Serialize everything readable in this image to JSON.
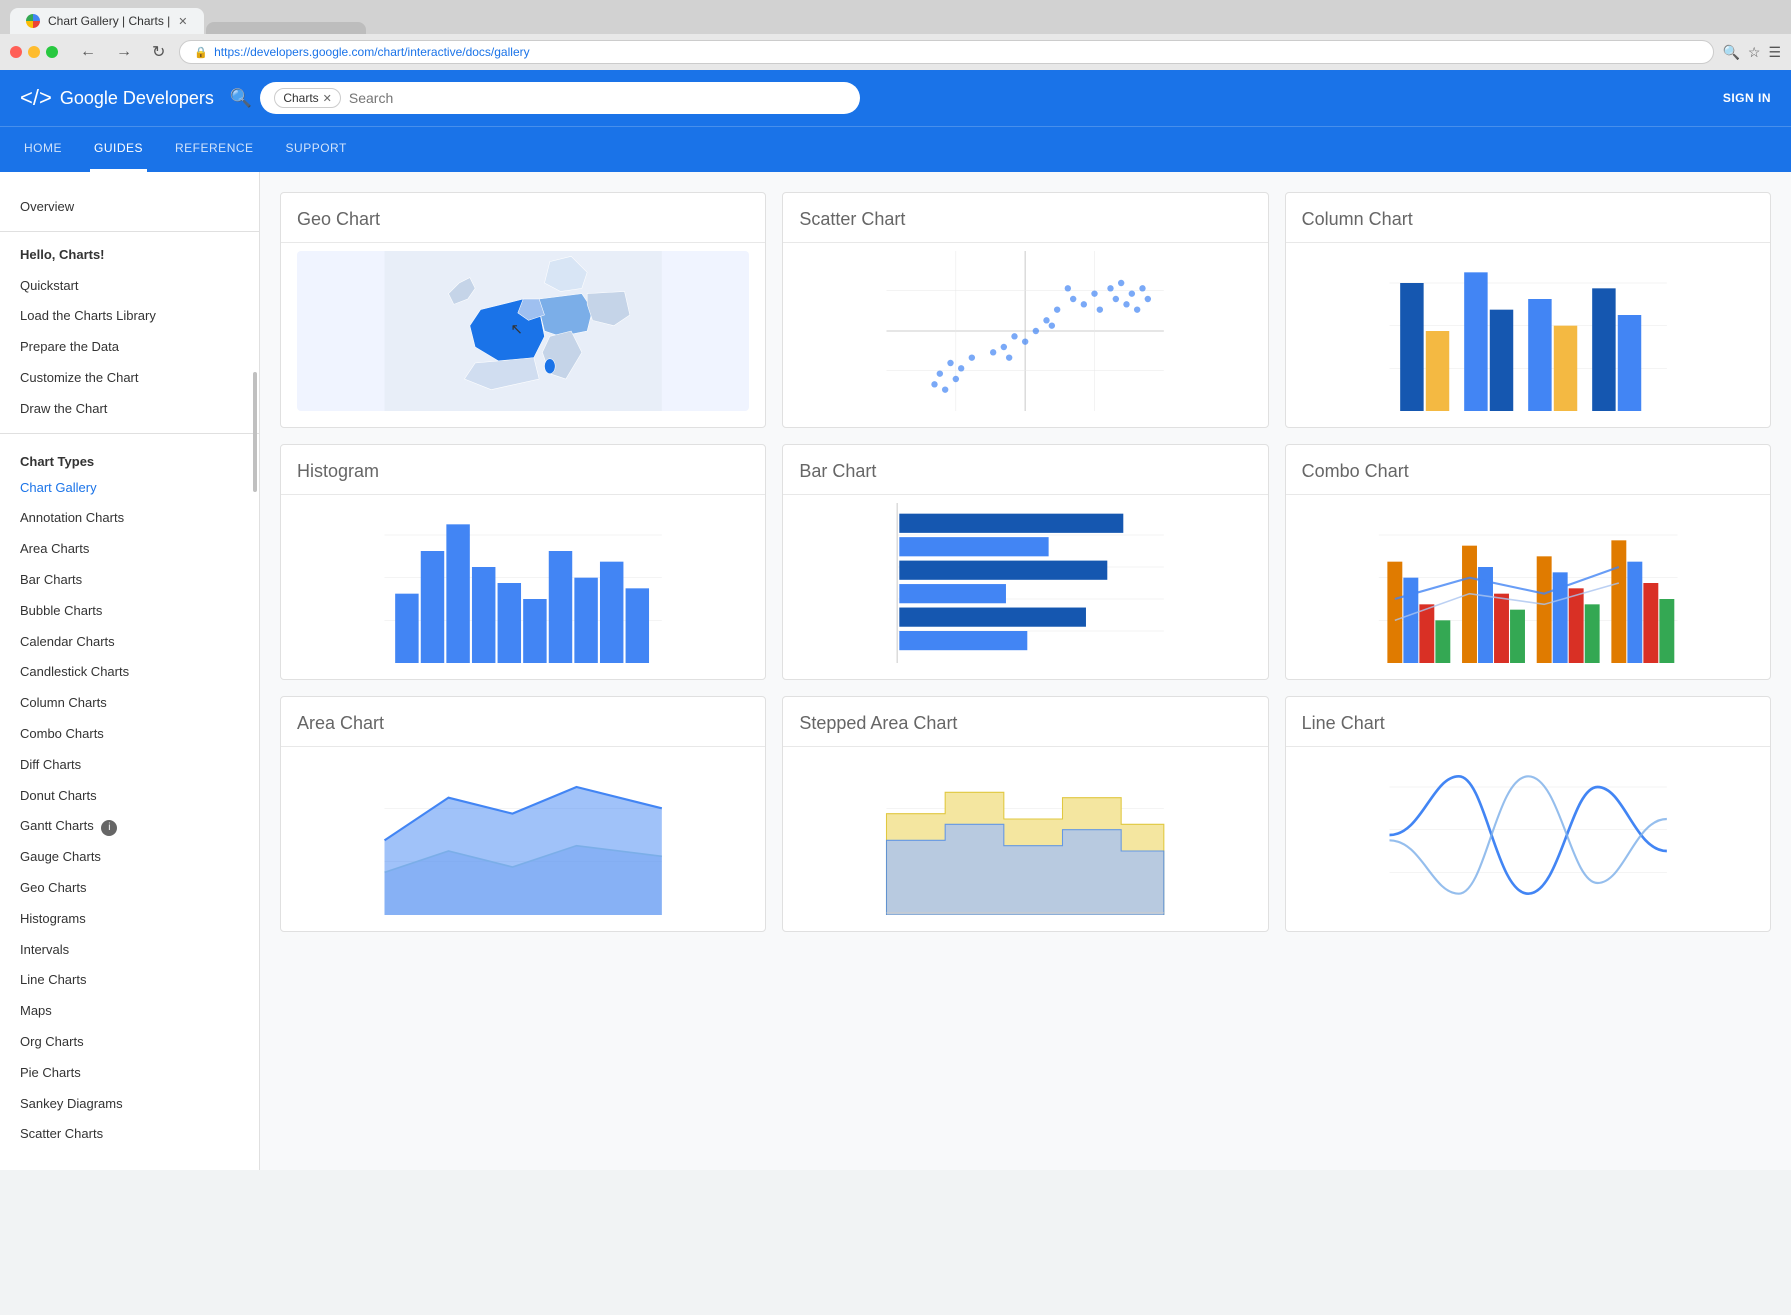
{
  "browser": {
    "tab_favicon": "chart-favicon",
    "tab_title": "Chart Gallery | Charts |",
    "url": "https://developers.google.com/chart/interactive/docs/gallery",
    "search_placeholder": "Search"
  },
  "header": {
    "logo_text": "Google Developers",
    "search_tag": "Charts",
    "search_placeholder": "Search",
    "sign_in": "SIGN IN"
  },
  "nav": {
    "items": [
      {
        "label": "HOME",
        "active": false
      },
      {
        "label": "GUIDES",
        "active": true
      },
      {
        "label": "REFERENCE",
        "active": false
      },
      {
        "label": "SUPPORT",
        "active": false
      }
    ]
  },
  "sidebar": {
    "overview": "Overview",
    "hello_charts": "Hello, Charts!",
    "items": [
      {
        "label": "Quickstart"
      },
      {
        "label": "Load the Charts Library"
      },
      {
        "label": "Prepare the Data"
      },
      {
        "label": "Customize the Chart"
      },
      {
        "label": "Draw the Chart"
      },
      {
        "label": "Chart Types",
        "type": "section"
      },
      {
        "label": "Chart Gallery",
        "active": true
      },
      {
        "label": "Annotation Charts"
      },
      {
        "label": "Area Charts"
      },
      {
        "label": "Bar Charts"
      },
      {
        "label": "Bubble Charts"
      },
      {
        "label": "Calendar Charts"
      },
      {
        "label": "Candlestick Charts"
      },
      {
        "label": "Column Charts"
      },
      {
        "label": "Combo Charts"
      },
      {
        "label": "Diff Charts"
      },
      {
        "label": "Donut Charts"
      },
      {
        "label": "Gantt Charts",
        "badge": true
      },
      {
        "label": "Gauge Charts"
      },
      {
        "label": "Geo Charts"
      },
      {
        "label": "Histograms"
      },
      {
        "label": "Intervals"
      },
      {
        "label": "Line Charts"
      },
      {
        "label": "Maps"
      },
      {
        "label": "Org Charts"
      },
      {
        "label": "Pie Charts"
      },
      {
        "label": "Sankey Diagrams"
      },
      {
        "label": "Scatter Charts"
      }
    ]
  },
  "charts": [
    {
      "title": "Geo Chart",
      "type": "geo"
    },
    {
      "title": "Scatter Chart",
      "type": "scatter"
    },
    {
      "title": "Column Chart",
      "type": "column"
    },
    {
      "title": "Histogram",
      "type": "histogram"
    },
    {
      "title": "Bar Chart",
      "type": "bar"
    },
    {
      "title": "Combo Chart",
      "type": "combo"
    },
    {
      "title": "Area Chart",
      "type": "area"
    },
    {
      "title": "Stepped Area Chart",
      "type": "stepped"
    },
    {
      "title": "Line Chart",
      "type": "line"
    }
  ],
  "colors": {
    "blue_primary": "#1a73e8",
    "blue_dark": "#1557b0",
    "blue_medium": "#4285f4",
    "blue_light": "#aac4f0",
    "yellow": "#f4b942",
    "orange": "#e07b00",
    "red": "#d93025",
    "green": "#34a853"
  }
}
